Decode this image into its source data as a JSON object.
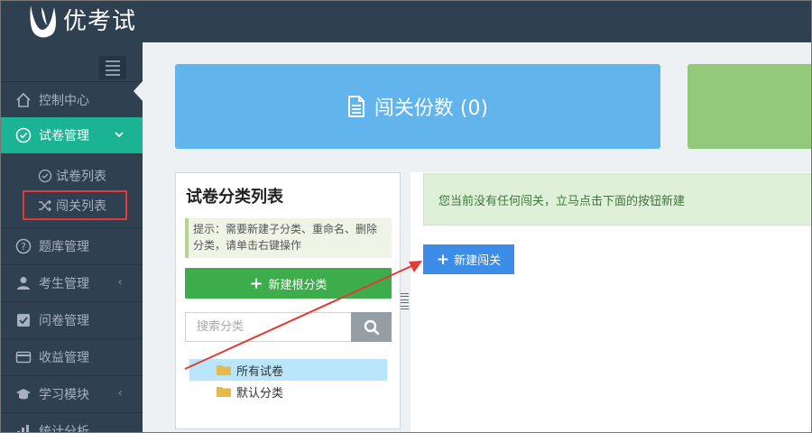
{
  "app": {
    "brand": "优考试"
  },
  "sidebar": {
    "items": [
      {
        "label": "控制中心",
        "icon": "home-icon"
      },
      {
        "label": "试卷管理",
        "icon": "check-circle-icon",
        "active": true
      },
      {
        "label": "题库管理",
        "icon": "question-icon"
      },
      {
        "label": "考生管理",
        "icon": "user-icon"
      },
      {
        "label": "问卷管理",
        "icon": "checkbox-icon"
      },
      {
        "label": "收益管理",
        "icon": "card-icon"
      },
      {
        "label": "学习模块",
        "icon": "graduation-cap-icon"
      },
      {
        "label": "统计分析",
        "icon": "bar-chart-icon"
      }
    ],
    "subitems": [
      {
        "label": "试卷列表",
        "icon": "check-circle-icon"
      },
      {
        "label": "闯关列表",
        "icon": "shuffle-icon",
        "highlighted": true
      }
    ]
  },
  "stats": {
    "card_label": "闯关份数 (0)"
  },
  "category_panel": {
    "title": "试卷分类列表",
    "tip": "提示：需要新建子分类、重命名、删除分类，请单击右键操作",
    "new_root_label": "新建根分类",
    "search_placeholder": "搜索分类",
    "tree": [
      {
        "label": "所有试卷",
        "selected": true
      },
      {
        "label": "默认分类",
        "selected": false
      }
    ]
  },
  "main": {
    "notice": "您当前没有任何闯关，立马点击下面的按钮新建",
    "new_button_label": "新建闯关"
  },
  "colors": {
    "sidebar_bg": "#2f4050",
    "active": "#1ab394",
    "card_blue": "#62b4ec",
    "card_green": "#93c97a",
    "btn_green": "#3cad4a",
    "btn_blue": "#3c8de8",
    "highlight_red": "#e53935"
  }
}
